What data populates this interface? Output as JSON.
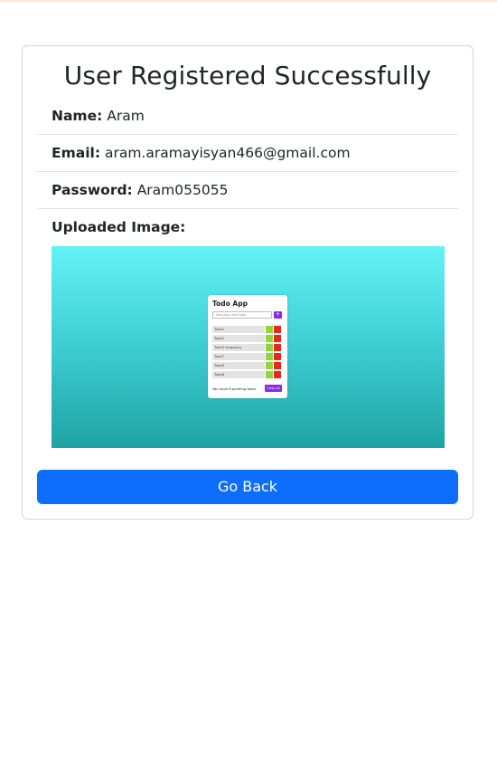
{
  "page": {
    "title": "User Registered Successfully"
  },
  "fields": {
    "name_label": "Name:",
    "name_value": "Aram",
    "email_label": "Email:",
    "email_value": "aram.aramayisyan466@gmail.com",
    "password_label": "Password:",
    "password_value": "Aram055055",
    "image_label": "Uploaded Image:"
  },
  "preview": {
    "app_title": "Todo App",
    "input_placeholder": "Add your new todo",
    "add_label": "+",
    "todos": [
      "Todo1",
      "Todo2",
      "Todo3 shopping",
      "Todo7",
      "Todo9",
      "Todo8"
    ],
    "footer_text": "You have 6 pending tasks",
    "clear_label": "Clear All"
  },
  "actions": {
    "go_back_label": "Go Back"
  },
  "colors": {
    "primary": "#0d6efd",
    "gradient_top": "#63f2f6",
    "gradient_bottom": "#1ea3a3",
    "todo_edit": "#8fd63a",
    "todo_delete": "#e8281c",
    "todo_accent": "#8a2be2"
  }
}
